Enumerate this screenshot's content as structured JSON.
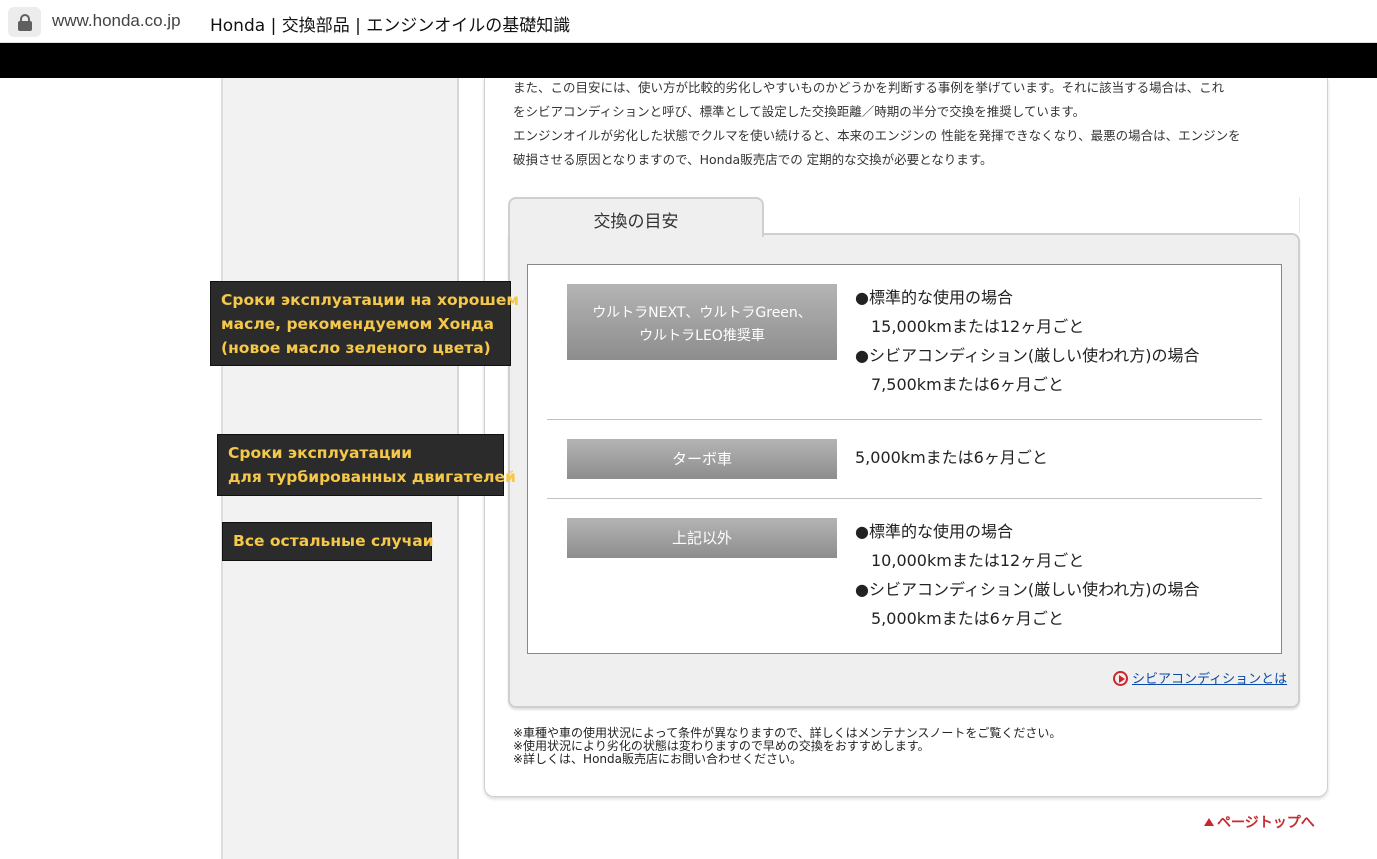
{
  "browser": {
    "url": "www.honda.co.jp",
    "page_title": "Honda | 交換部品 | エンジンオイルの基礎知識"
  },
  "intro": {
    "lines": [
      "また、この目安には、使い方が比較的劣化しやすいものかどうかを判断する事例を挙げています。それに該当する場合は、これ",
      "をシビアコンディションと呼び、標準として設定した交換距離／時期の半分で交換を推奨しています。",
      "エンジンオイルが劣化した状態でクルマを使い続けると、本来のエンジンの 性能を発揮できなくなり、最悪の場合は、エンジンを",
      "破損させる原因となりますので、Honda販売店での 定期的な交換が必要となります。"
    ]
  },
  "tab": {
    "label": "交換の目安"
  },
  "rows": [
    {
      "label_lines": [
        "ウルトラNEXT、ウルトラGreen、",
        "ウルトラLEO推奨車"
      ],
      "lines": [
        "●標準的な使用の場合",
        "15,000kmまたは12ヶ月ごと",
        "●シビアコンディション(厳しい使われ方)の場合",
        "7,500kmまたは6ヶ月ごと"
      ]
    },
    {
      "label": "ターボ車",
      "lines": [
        "5,000kmまたは6ヶ月ごと"
      ]
    },
    {
      "label": "上記以外",
      "lines": [
        "●標準的な使用の場合",
        "10,000kmまたは12ヶ月ごと",
        "●シビアコンディション(厳しい使われ方)の場合",
        "5,000kmまたは6ヶ月ごと"
      ]
    }
  ],
  "severe_link": {
    "text": "シビアコンディションとは",
    "icon": "play-circle-icon"
  },
  "notes": [
    "※車種や車の使用状況によって条件が異なりますので、詳しくはメンテナンスノートをご覧ください。",
    "※使用状況により劣化の状態は変わりますので早めの交換をおすすめします。",
    "※詳しくは、Honda販売店にお問い合わせください。"
  ],
  "page_top": {
    "text": "ページトップへ",
    "icon": "triangle-up-icon"
  },
  "annotations": [
    {
      "lines": [
        "Сроки эксплуатации на хорошем",
        "масле, рекомендуемом Хонда",
        "(новое масло зеленого цвета)"
      ]
    },
    {
      "lines": [
        "Сроки эксплуатации",
        "для турбированных двигателей"
      ]
    },
    {
      "lines": [
        "Все остальные случаи"
      ]
    }
  ],
  "colors": {
    "accent_red": "#c8282d",
    "link_blue": "#0a4aa8",
    "callout_bg": "#2b2b2b",
    "callout_text": "#f5c84a"
  }
}
